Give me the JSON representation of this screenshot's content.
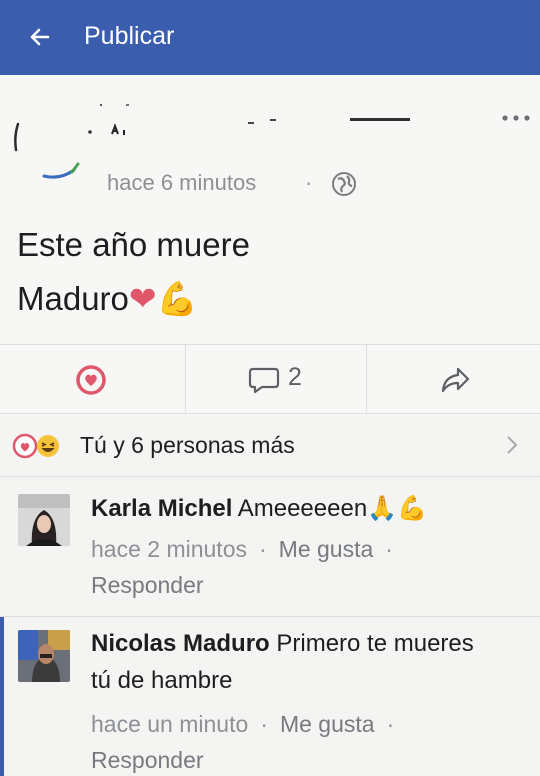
{
  "header": {
    "title": "Publicar"
  },
  "post": {
    "time": "hace 6 minutos",
    "separator": "·",
    "text_line1": "Este año muere",
    "text_line2": "Maduro",
    "emoji_heart": "❤",
    "emoji_muscle": "💪",
    "comment_count": "2"
  },
  "reactions": {
    "summary": "Tú y 6 personas más"
  },
  "comments": [
    {
      "author": "Karla Michel",
      "text": "Ameeeeeen🙏💪",
      "time": "hace 2 minutos",
      "like": "Me gusta",
      "reply": "Responder"
    },
    {
      "author": "Nicolas Maduro",
      "text_line1": "Primero te mueres",
      "text_line2": "tú de hambre",
      "time": "hace un minuto",
      "like": "Me gusta",
      "reply": "Responder"
    }
  ],
  "icons": {
    "back": "arrow-left-icon",
    "more": "more-horizontal-icon",
    "privacy": "globe-icon",
    "love": "heart-outline-icon",
    "comment": "comment-bubble-icon",
    "share": "share-arrow-icon",
    "chevron": "chevron-right-icon"
  },
  "colors": {
    "brand": "#3b5dae",
    "love": "#e0566a",
    "meta": "#8d9096"
  }
}
